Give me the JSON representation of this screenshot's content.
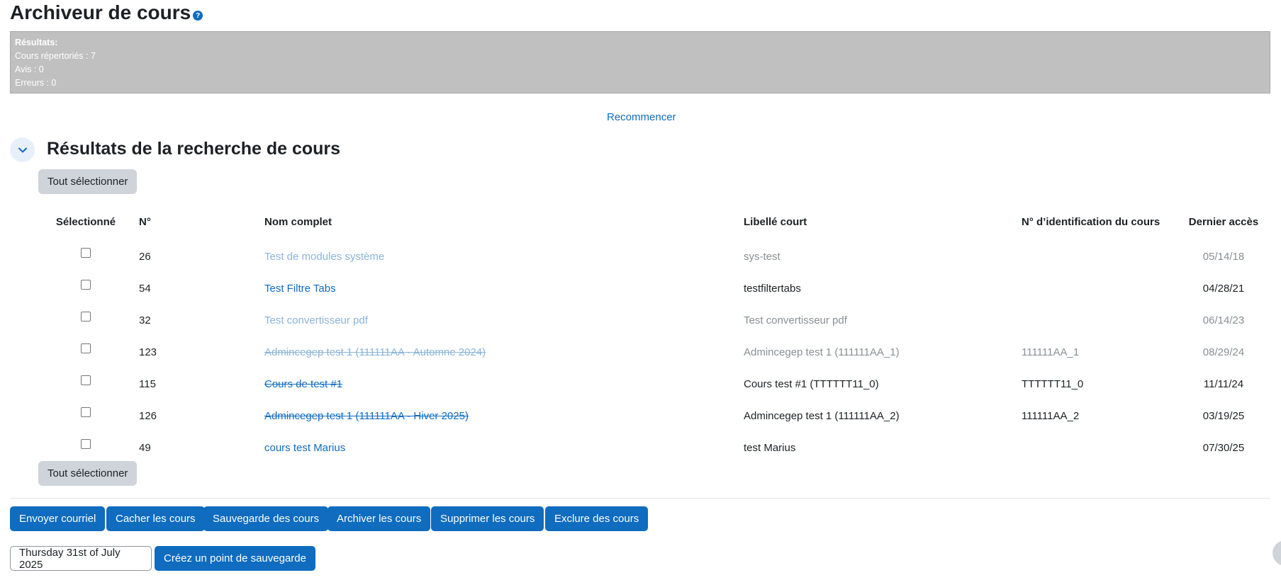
{
  "page": {
    "title": "Archiveur de cours",
    "help_icon": "question-icon"
  },
  "results": {
    "heading": "Résultats:",
    "courses_listed": "Cours répertoriés : 7",
    "notices": "Avis : 0",
    "errors": "Erreurs : 0"
  },
  "restart_label": "Recommencer",
  "section": {
    "title": "Résultats de la recherche de cours",
    "collapse_icon": "chevron-down-icon"
  },
  "select_all_label": "Tout sélectionner",
  "table": {
    "headers": {
      "selected": "Sélectionné",
      "number": "N°",
      "fullname": "Nom complet",
      "shortname": "Libellé court",
      "idnumber": "N° d’identification du cours",
      "lastaccess": "Dernier accès"
    },
    "rows": [
      {
        "number": "26",
        "fullname": "Test de modules système",
        "shortname": "sys-test",
        "idnumber": "",
        "lastaccess": "05/14/18"
      },
      {
        "number": "54",
        "fullname": "Test Filtre Tabs",
        "shortname": "testfiltertabs",
        "idnumber": "",
        "lastaccess": "04/28/21"
      },
      {
        "number": "32",
        "fullname": "Test convertisseur pdf",
        "shortname": "Test convertisseur pdf",
        "idnumber": "",
        "lastaccess": "06/14/23"
      },
      {
        "number": "123",
        "fullname": "Admincegep test 1 (111111AA - Automne 2024)",
        "shortname": "Admincegep test 1 (111111AA_1)",
        "idnumber": "111111AA_1",
        "lastaccess": "08/29/24"
      },
      {
        "number": "115",
        "fullname": "Cours de test #1",
        "shortname": "Cours test #1 (TTTTTT11_0)",
        "idnumber": "TTTTTT11_0",
        "lastaccess": "11/11/24"
      },
      {
        "number": "126",
        "fullname": "Admincegep test 1 (111111AA - Hiver 2025)",
        "shortname": "Admincegep test 1 (111111AA_2)",
        "idnumber": "111111AA_2",
        "lastaccess": "03/19/25"
      },
      {
        "number": "49",
        "fullname": "cours test Marius",
        "shortname": "test Marius",
        "idnumber": "",
        "lastaccess": "07/30/25"
      }
    ]
  },
  "actions": {
    "email": "Envoyer courriel",
    "hide": "Cacher les cours",
    "backup": "Sauvegarde des cours",
    "archive": "Archiver les cours",
    "delete": "Supprimer les cours",
    "exclude": "Exclure des cours"
  },
  "save_point": {
    "date_value": "Thursday 31st of July 2025",
    "create_label": "Créez un point de sauvegarde"
  }
}
